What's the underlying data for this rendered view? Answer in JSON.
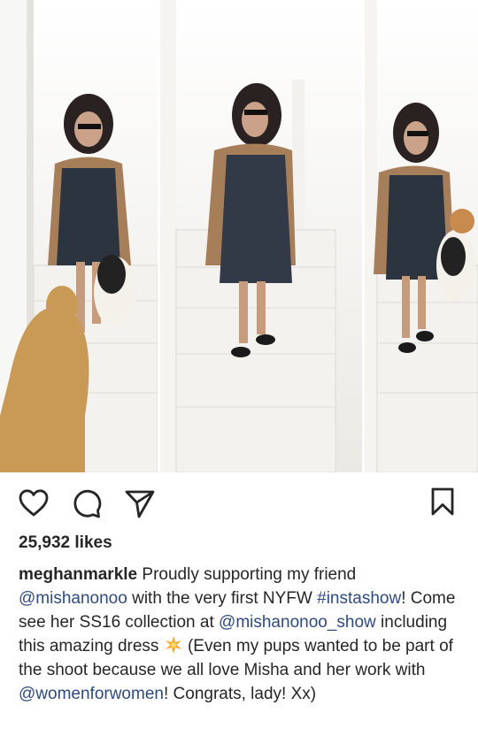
{
  "post": {
    "likes": "25,932 likes",
    "caption": {
      "username": "meghanmarkle",
      "t1": " Proudly supporting my friend ",
      "m1": "@mishanonoo",
      "t2": " with the very first NYFW ",
      "h1": "#instashow",
      "t3": "! Come see her SS16 collection at ",
      "m2": "@mishanonoo_show",
      "t4": " including this amazing dress ",
      "t5": " (Even my pups wanted to be part of the shoot because we all love Misha and her work with ",
      "m3": "@womenforwomen",
      "t6": "! Congrats, lady! Xx)"
    }
  },
  "icons": {
    "like": "heart-icon",
    "comment": "comment-icon",
    "share": "send-icon",
    "save": "bookmark-icon",
    "emoji": "sparkle-emoji"
  },
  "colors": {
    "text": "#262626",
    "link": "#2f4a7d",
    "sparkle": "#f5a623"
  }
}
